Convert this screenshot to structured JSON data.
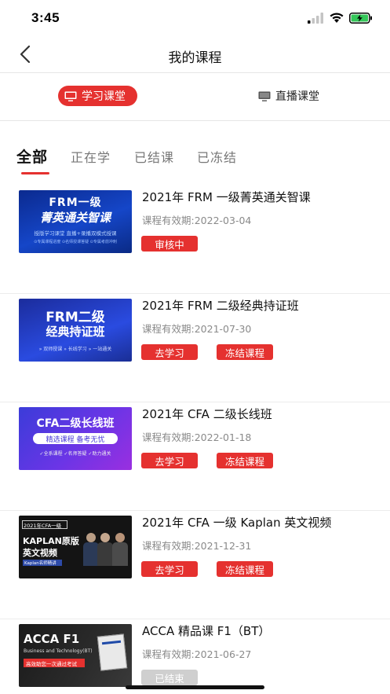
{
  "status_bar": {
    "time": "3:45"
  },
  "nav": {
    "title": "我的课程"
  },
  "mode_tabs": [
    {
      "label": "学习课堂",
      "active": true,
      "icon": "monitor-icon"
    },
    {
      "label": "直播课堂",
      "active": false,
      "icon": "monitor-icon"
    }
  ],
  "filter_tabs": [
    {
      "label": "全部",
      "active": true
    },
    {
      "label": "正在学",
      "active": false
    },
    {
      "label": "已结课",
      "active": false
    },
    {
      "label": "已冻结",
      "active": false
    }
  ],
  "courses": [
    {
      "title": "2021年 FRM 一级菁英通关智课",
      "validity": "课程有效期:2022-03-04",
      "buttons": [
        "审核中"
      ],
      "thumb": {
        "line1": "FRM一级",
        "line2": "菁英通关智课",
        "line3": "授版学习课堂  直播+录播双模式授课",
        "line4": "⊙专属课程进度  ⊙名师授课答疑  ⊙专属考前冲刺"
      }
    },
    {
      "title": "2021年 FRM 二级经典持证班",
      "validity": "课程有效期:2021-07-30",
      "buttons": [
        "去学习",
        "冻结课程"
      ],
      "thumb": {
        "line1": "FRM二级",
        "line2": "经典持证班",
        "line3": "» 双师授课  » 长线学习  » 一站通关"
      }
    },
    {
      "title": "2021年 CFA 二级长线班",
      "validity": "课程有效期:2022-01-18",
      "buttons": [
        "去学习",
        "冻结课程"
      ],
      "thumb": {
        "line1": "CFA二级长线班",
        "line2": "精选课程  备考无忧",
        "line3": "✓全系课程  ✓名师答疑  ✓助力通关"
      }
    },
    {
      "title": "2021年 CFA 一级 Kaplan 英文视频",
      "validity": "课程有效期:2021-12-31",
      "buttons": [
        "去学习",
        "冻结课程"
      ],
      "thumb": {
        "line1": "2021年CFA一级",
        "line2": "KAPLAN原版",
        "line3": "英文视频",
        "line4": "Kaplan名师精讲"
      }
    },
    {
      "title": "ACCA 精品课  F1（BT）",
      "validity": "课程有效期:2021-06-27",
      "buttons": [
        "已结束"
      ],
      "thumb": {
        "line1": "ACCA F1",
        "line2": "Business and Technology(BT)",
        "line3": "高效助您一次通过考试"
      }
    }
  ],
  "colors": {
    "accent": "#e5312f",
    "muted": "#8a8a8a",
    "disabled": "#cfcfcf"
  }
}
